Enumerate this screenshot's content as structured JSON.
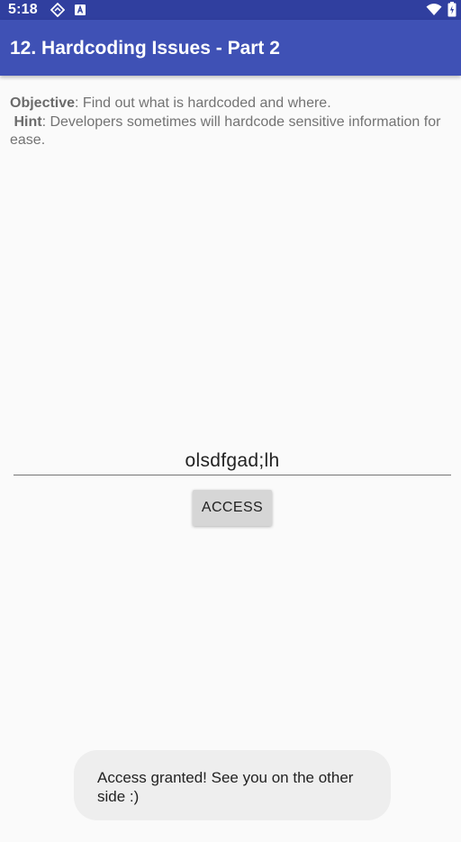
{
  "status_bar": {
    "time": "5:18",
    "icons": [
      "notification-diamond-icon",
      "keyboard-a-icon",
      "wifi-icon",
      "battery-icon"
    ],
    "background_color": "#303f9f"
  },
  "app_bar": {
    "title": "12. Hardcoding Issues - Part 2",
    "background_color": "#3f51b5"
  },
  "content": {
    "objective_label": "Objective",
    "objective_text": ": Find out what is hardcoded and where.",
    "hint_label": "Hint",
    "hint_text": ": Developers sometimes will hardcode sensitive information for ease."
  },
  "input": {
    "value": "olsdfgad;lh"
  },
  "access_button": {
    "label": "ACCESS"
  },
  "toast": {
    "message": "Access granted! See you on the other side :)"
  }
}
